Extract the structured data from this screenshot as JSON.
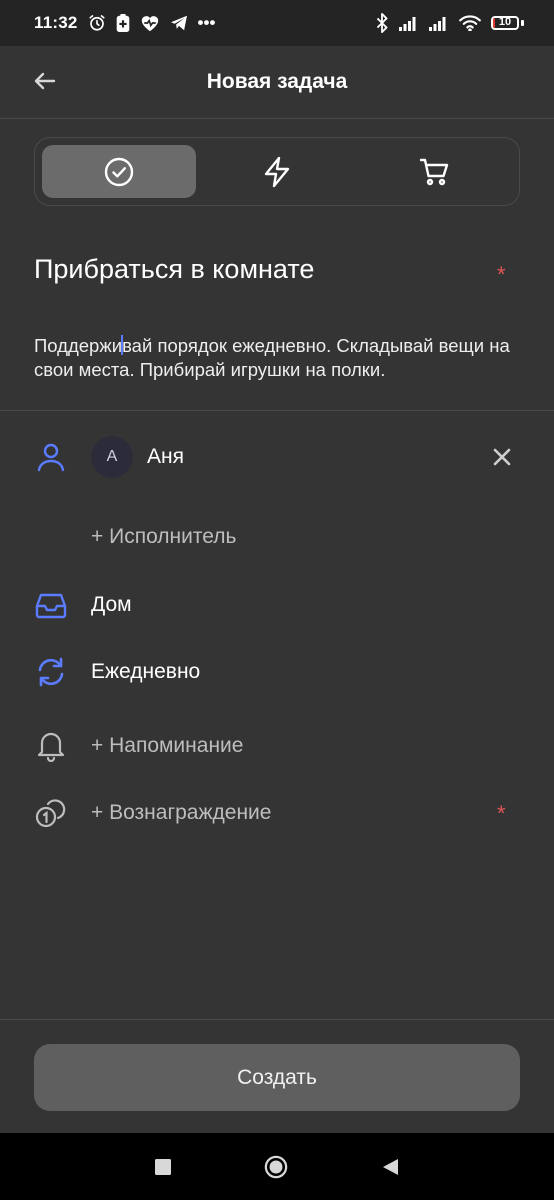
{
  "status_bar": {
    "time": "11:32",
    "more": "•••",
    "battery_level": "10",
    "battery_fraction": 0.1,
    "icons": [
      "alarm-icon",
      "battery-saver-icon",
      "heart-icon",
      "telegram-icon",
      "bluetooth-icon",
      "signal-icon",
      "signal-icon",
      "wifi-icon"
    ]
  },
  "header": {
    "title": "Новая задача",
    "back_icon": "arrow-left-icon"
  },
  "task_types": [
    {
      "icon": "check-circle-icon",
      "selected": true
    },
    {
      "icon": "lightning-icon",
      "selected": false
    },
    {
      "icon": "shopping-cart-icon",
      "selected": false
    }
  ],
  "task": {
    "title": "Прибраться в комнате",
    "required_mark": "*",
    "description_before_caret": "Поддержи",
    "description_after_caret": "вай порядок ежедневно. Складывай вещи на свои места. Прибирай игрушки на полки."
  },
  "assignee": {
    "avatar_letter": "А",
    "name": "Аня",
    "add_label": "+ Исполнитель"
  },
  "category": {
    "label": "Дом",
    "icon": "inbox-icon"
  },
  "repeat": {
    "label": "Ежедневно",
    "icon": "refresh-icon"
  },
  "reminder": {
    "label": "+ Напоминание",
    "icon": "bell-icon"
  },
  "reward": {
    "label": "+ Вознаграждение",
    "icon": "coins-icon",
    "required_mark": "*"
  },
  "actions": {
    "create_label": "Создать"
  },
  "colors": {
    "background": "#343434",
    "accent": "#5b7cff",
    "required": "#e05555",
    "button": "#5f5f5f"
  }
}
